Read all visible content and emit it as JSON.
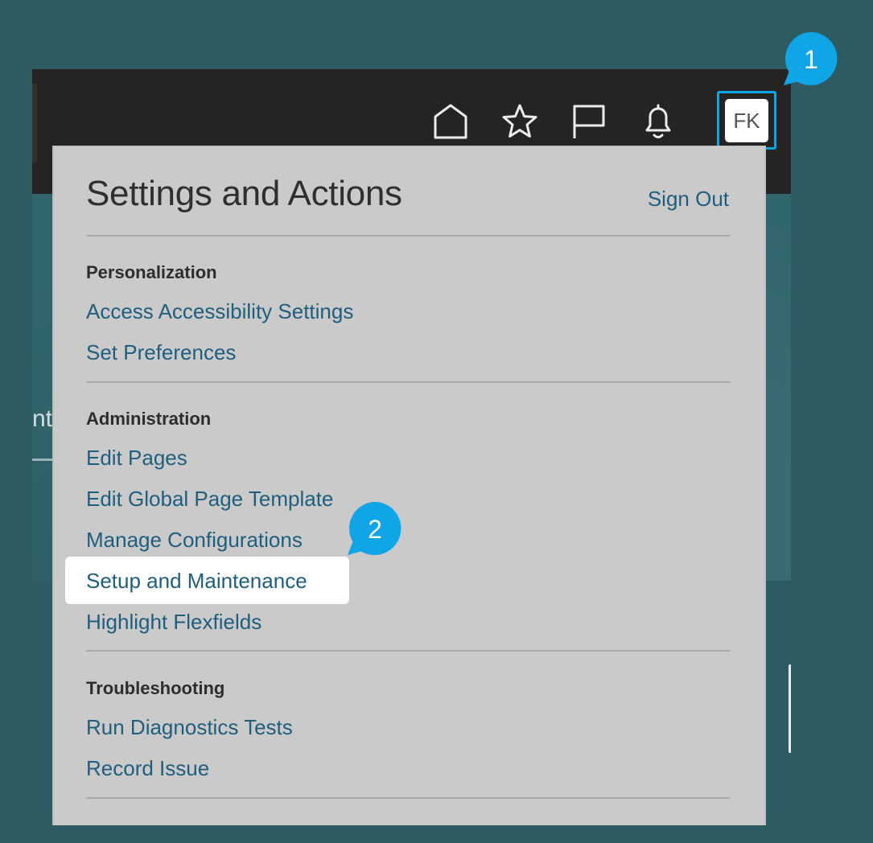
{
  "header": {
    "icons": [
      "home-icon",
      "star-icon",
      "flag-icon",
      "bell-icon"
    ],
    "avatar_initials": "FK"
  },
  "background": {
    "partial_text": "nt"
  },
  "menu": {
    "title": "Settings and Actions",
    "sign_out": "Sign Out",
    "sections": [
      {
        "heading": "Personalization",
        "items": [
          "Access Accessibility Settings",
          "Set Preferences"
        ]
      },
      {
        "heading": "Administration",
        "items": [
          "Edit Pages",
          "Edit Global Page Template",
          "Manage Configurations",
          "Setup and Maintenance",
          "Highlight Flexfields"
        ]
      },
      {
        "heading": "Troubleshooting",
        "items": [
          "Run Diagnostics Tests",
          "Record Issue"
        ]
      }
    ],
    "highlighted_item": "Setup and Maintenance"
  },
  "callouts": [
    {
      "number": "1",
      "target": "avatar"
    },
    {
      "number": "2",
      "target": "Setup and Maintenance"
    }
  ],
  "colors": {
    "page_background": "#2e5a62",
    "header_background": "#262422",
    "dropdown_background": "#cacaca",
    "link": "#1f5e7d",
    "callout": "#10a5e6",
    "highlight": "#ffffff"
  }
}
